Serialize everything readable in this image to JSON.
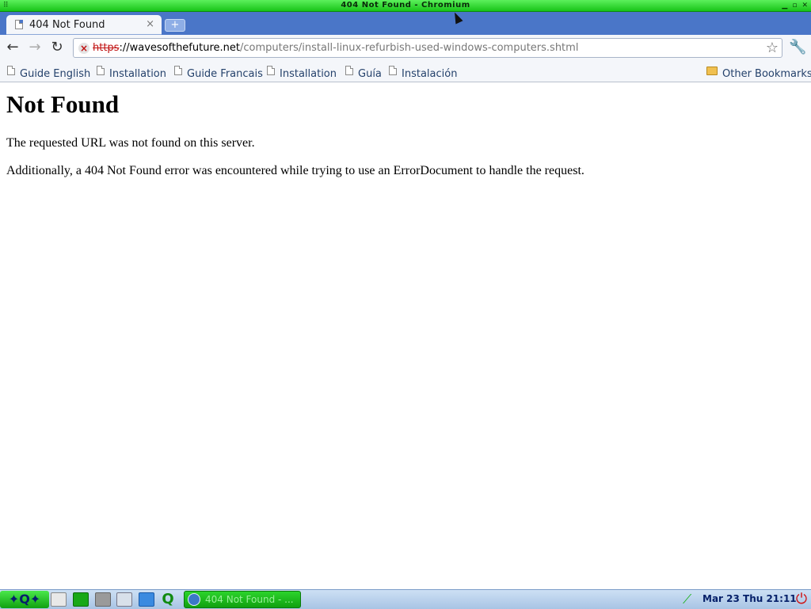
{
  "window": {
    "title": "404 Not Found - Chromium",
    "controls": [
      "minimize-icon",
      "maximize-icon",
      "close-icon"
    ]
  },
  "tabs": [
    {
      "label": "404 Not Found",
      "close_glyph": "×",
      "active": true
    }
  ],
  "new_tab_glyph": "+",
  "toolbar": {
    "back_glyph": "←",
    "forward_glyph": "→",
    "reload_glyph": "↻",
    "wrench_glyph": "🔧"
  },
  "omnibox": {
    "scheme": "https",
    "scheme_sep": "://",
    "host": "wavesofthefuture.net",
    "path": "/computers/install-linux-refurbish-used-windows-computers.shtml",
    "security_state": "broken-ssl",
    "star_glyph": "☆"
  },
  "bookmarks": [
    {
      "label": "Guide English"
    },
    {
      "label": "Installation"
    },
    {
      "label": "Guide Francais"
    },
    {
      "label": "Installation"
    },
    {
      "label": "Guía"
    },
    {
      "label": "Instalación"
    }
  ],
  "other_bookmarks": "Other Bookmarks",
  "page": {
    "heading": "Not Found",
    "paragraph1": "The requested URL was not found on this server.",
    "paragraph2": "Additionally, a 404 Not Found error was encountered while trying to use an ErrorDocument to handle the request."
  },
  "taskbar": {
    "start_label": "✦Q✦",
    "tasks": [
      {
        "label": "404 Not Found - ..."
      }
    ],
    "clock": "Mar 23 Thu 21:11",
    "power_glyph": "⏻"
  },
  "colors": {
    "titlebar": "#1ec81e",
    "tabstrip": "#4a76c8",
    "toolbar": "#f4f6fa",
    "bookmark_text": "#24416b",
    "broken_ssl": "#c01010"
  }
}
